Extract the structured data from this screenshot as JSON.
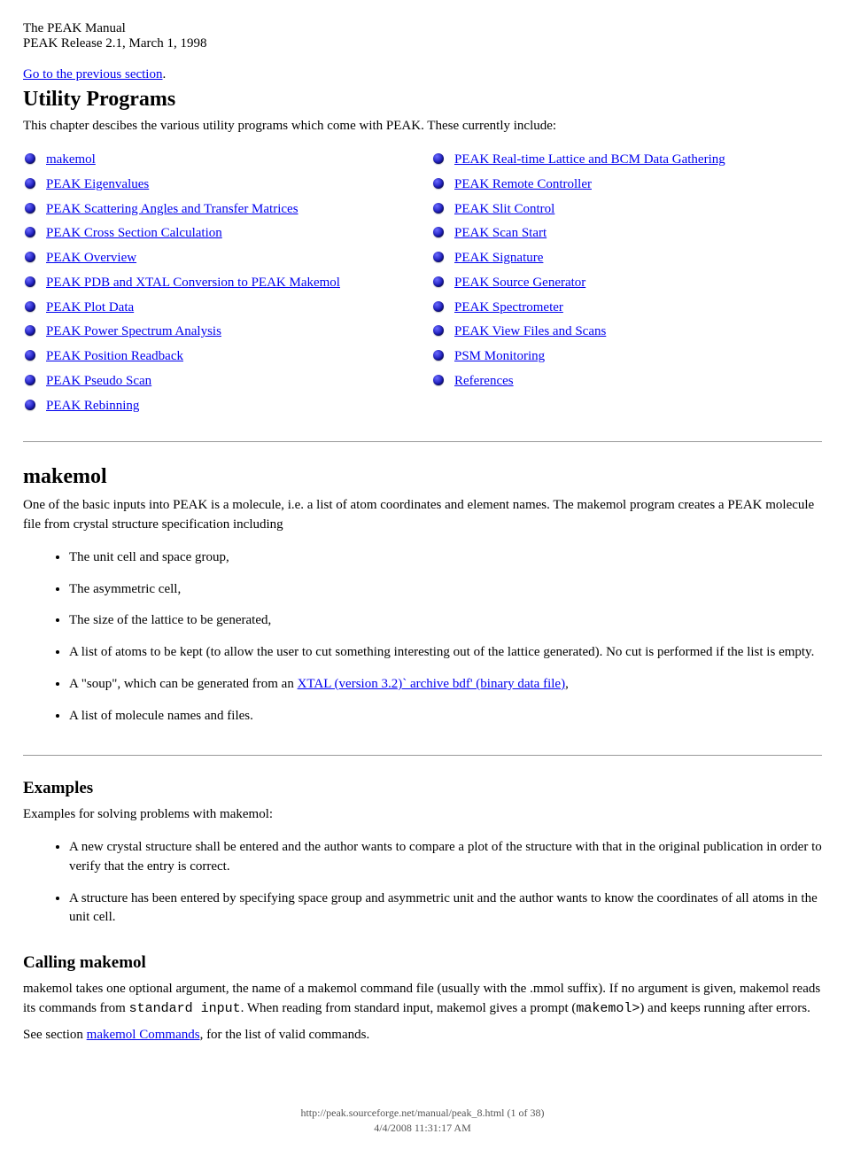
{
  "header": {
    "line1": "The PEAK Manual",
    "line2": "PEAK Release 2.1, March 1, 1998",
    "prev_label": "Go to the previous section",
    "prev_href": "#"
  },
  "toc": {
    "title": "Utility Programs",
    "intro": "This chapter descibes the various utility programs which come with PEAK. These currently include:",
    "left": [
      {
        "label": "makemol",
        "href": "#"
      },
      {
        "label": "PEAK Eigenvalues",
        "href": "#"
      },
      {
        "label": "PEAK Scattering Angles and Transfer Matrices",
        "href": "#"
      },
      {
        "label": "PEAK Cross Section Calculation",
        "href": "#"
      },
      {
        "label": "PEAK Overview",
        "href": "#"
      },
      {
        "label": "PEAK PDB and XTAL Conversion to PEAK Makemol",
        "href": "#"
      },
      {
        "label": "PEAK Plot Data",
        "href": "#"
      },
      {
        "label": "PEAK Power Spectrum Analysis",
        "href": "#"
      },
      {
        "label": "PEAK Position Readback",
        "href": "#"
      },
      {
        "label": "PEAK Pseudo Scan",
        "href": "#"
      },
      {
        "label": "PEAK Rebinning",
        "href": "#"
      }
    ],
    "right": [
      {
        "label": "PEAK Real-time Lattice and BCM Data Gathering",
        "href": "#"
      },
      {
        "label": "PEAK Remote Controller",
        "href": "#"
      },
      {
        "label": "PEAK Slit Control",
        "href": "#"
      },
      {
        "label": "PEAK Scan Start",
        "href": "#"
      },
      {
        "label": "PEAK Signature",
        "href": "#"
      },
      {
        "label": "PEAK Source Generator",
        "href": "#"
      },
      {
        "label": "PEAK Spectrometer",
        "href": "#"
      },
      {
        "label": "PEAK View Files and Scans",
        "href": "#"
      },
      {
        "label": "PSM Monitoring",
        "href": "#"
      },
      {
        "label": "References",
        "href": "#"
      }
    ]
  },
  "makemol": {
    "title": "makemol",
    "intro": "One of the basic inputs into PEAK is a molecule, i.e. a list of atom coordinates and element names. The makemol program creates a PEAK molecule file from crystal structure specification including",
    "items": [
      "The unit cell and space group,",
      "The asymmetric cell,",
      "The size of the lattice to be generated,",
      "A list of atoms to be kept (to allow the user to cut something interesting out of the lattice generated). No cut is performed if the list is empty.",
      {
        "prefix": "A \"soup\", which can be generated from an ",
        "link_label": "XTAL (version 3.2)` archive bdf' (binary data file)",
        "link_href": "#",
        "suffix": ","
      },
      "A list of molecule names and files."
    ]
  },
  "examples": {
    "title": "Examples",
    "intro": "Examples for solving problems with makemol:",
    "items": [
      "A new crystal structure shall be entered and the author wants to compare a plot of the structure with that in the original publication in order to verify that the entry is correct.",
      "A structure has been entered by specifying space group and asymmetric unit and the author wants to know the coordinates of all atoms in the unit cell."
    ]
  },
  "calling": {
    "title": "Calling makemol",
    "para": "makemol takes one optional argument, the name of a makemol command file (usually with the .mmol suffix). If no argument is given, makemol reads its commands from ",
    "code": "standard input",
    "para2": ". When reading from standard input, makemol gives a prompt (",
    "code2": "makemol>",
    "para3": ") and keeps running after errors.",
    "note_prefix": "See section ",
    "note_link": "makemol Commands",
    "note_href": "#",
    "note_suffix": ", for the list of valid commands."
  },
  "footer": {
    "url": "http://peak.sourceforge.net/manual/peak_8.html (1 of 38)",
    "date": "4/4/2008 11:31:17 AM"
  }
}
